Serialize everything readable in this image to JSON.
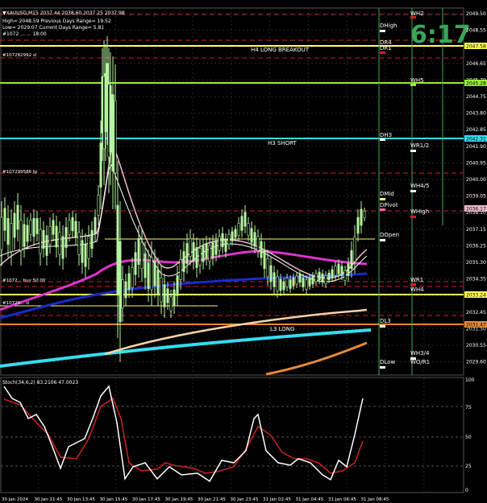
{
  "header": {
    "symbol_line": "▼XAUUSD,M15  2037.44 2038.60 2037.25 2037.98",
    "line2": "High= 2048.59   Previous Days Range= 19.52",
    "line3": "Low= 2029.07   Current Days Range= 5.81",
    "line4": "#1072 ... ... 18:00"
  },
  "clock": "6:17",
  "colors": {
    "background": "#000000",
    "grid": "#3a3a3a",
    "candle": "#b6f3a0",
    "clock": "#3aa65a",
    "yellow": "#ffff55",
    "lime": "#99ee33",
    "cyan": "#33ddee",
    "magenta": "#dd33cc",
    "blue": "#1a2acc",
    "pink": "#f0b8c8",
    "cream": "#f5d2a8",
    "orange": "#e58a3a",
    "red_dash": "#cc2222"
  },
  "price_axis": {
    "labels": [
      "2049.50",
      "2048.55",
      "2047.58",
      "2046.65",
      "2045.70",
      "2044.75",
      "2043.80",
      "2042.85",
      "2041.90",
      "2040.95",
      "2040.00",
      "2039.05",
      "2038.10",
      "2037.15",
      "2036.25",
      "2035.30",
      "2034.35",
      "2033.40",
      "2032.45",
      "2031.50",
      "2030.55",
      "2029.60"
    ],
    "highlight": [
      {
        "value": "2047.58",
        "bg": "#ffff55",
        "fg": "#000000"
      },
      {
        "value": "2045.28",
        "bg": "#99ee33",
        "fg": "#000000"
      },
      {
        "value": "2042.31",
        "bg": "#33ddee",
        "fg": "#000000"
      },
      {
        "value": "2036.17",
        "bg": "#f0b8c8",
        "fg": "#000000"
      },
      {
        "value": "2033.24",
        "bg": "#ffff55",
        "fg": "#000000"
      },
      {
        "value": "2031.47",
        "bg": "#e58a3a",
        "fg": "#000000"
      }
    ]
  },
  "level_labels": [
    {
      "text": "WH2",
      "color": "#ffffff"
    },
    {
      "text": "DHigh",
      "color": "#ffffff"
    },
    {
      "text": "DR4",
      "color": "#ffffff"
    },
    {
      "text": "DR1",
      "color": "#ffffff"
    },
    {
      "text": "H4 LONG BREAKOUT",
      "color": "#ffffff"
    },
    {
      "text": "WH5",
      "color": "#ffffff"
    },
    {
      "text": "DH3",
      "color": "#ffffff"
    },
    {
      "text": "H3 SHORT",
      "color": "#ffffff"
    },
    {
      "text": "WR1/2",
      "color": "#ffffff"
    },
    {
      "text": "WH4/5",
      "color": "#ffffff"
    },
    {
      "text": "DMid",
      "color": "#ffffff"
    },
    {
      "text": "DPivot",
      "color": "#ffffff"
    },
    {
      "text": "WHigh",
      "color": "#ffffff"
    },
    {
      "text": "DOpen",
      "color": "#ffffff"
    },
    {
      "text": "WR1",
      "color": "#ffffff"
    },
    {
      "text": "WH4",
      "color": "#ffffff"
    },
    {
      "text": "DL3",
      "color": "#ffffff"
    },
    {
      "text": "L3 LONG",
      "color": "#ffffff"
    },
    {
      "text": "WH3/4",
      "color": "#ffffff"
    },
    {
      "text": "DLow",
      "color": "#ffffff"
    },
    {
      "text": "WO/R1",
      "color": "#ffffff"
    }
  ],
  "order_labels": [
    "#107282992 sl",
    "#107299586 tp",
    "#1072... buy 50.00",
    "#10729... sl"
  ],
  "stoch": {
    "title": "Stoch(34,6,2) 83.2106 47.0023",
    "axis": [
      "100",
      "75",
      "50",
      "25",
      "0"
    ]
  },
  "time_axis": [
    "30 Jan 2024",
    "30 Jan 11:45",
    "30 Jan 13:45",
    "30 Jan 15:45",
    "30 Jan 17:45",
    "30 Jan 19:45",
    "30 Jan 21:45",
    "30 Jan 23:45",
    "31 Jan 02:45",
    "31 Jan 04:45",
    "31 Jan 06:45",
    "31 Jan 08:45"
  ]
}
